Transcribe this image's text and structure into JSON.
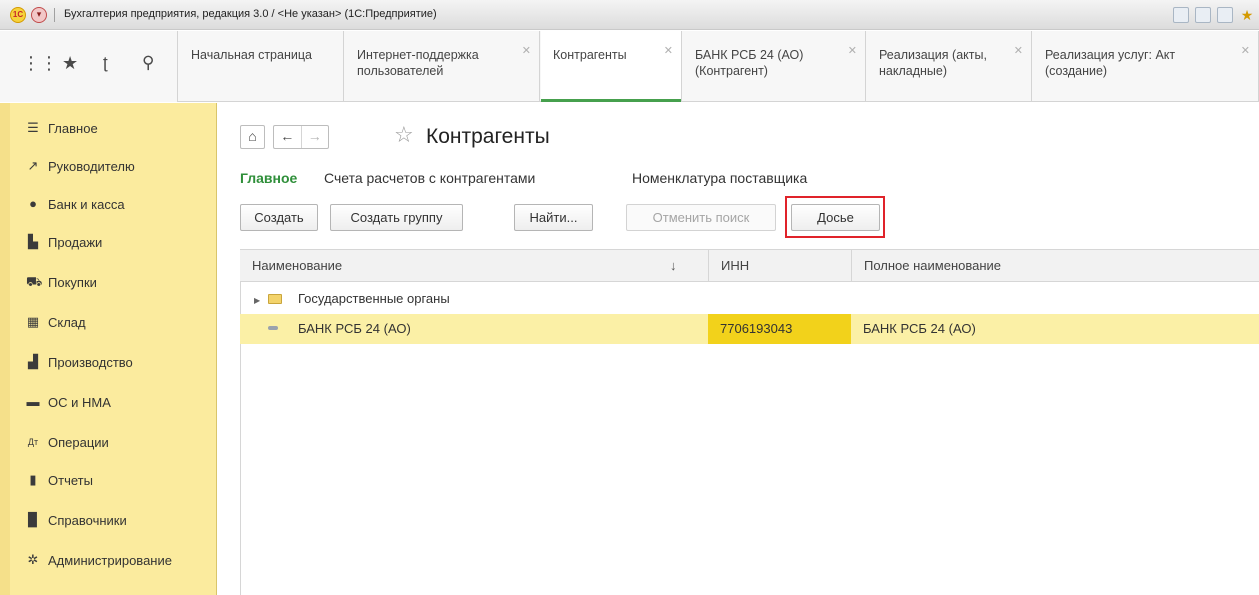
{
  "window": {
    "title": "Бухгалтерия предприятия, редакция 3.0 / <Не указан>  (1С:Предприятие)",
    "logo_text": "1С"
  },
  "quick_icons": [
    "grid-icon",
    "star-icon",
    "history-icon",
    "search-icon"
  ],
  "tabs": [
    {
      "label": "Начальная страница",
      "closable": false
    },
    {
      "label": "Интернет-поддержка пользователей",
      "closable": true
    },
    {
      "label": "Контрагенты",
      "closable": true,
      "active": true
    },
    {
      "label": "БАНК РСБ 24 (АО) (Контрагент)",
      "closable": true
    },
    {
      "label": "Реализация (акты, накладные)",
      "closable": true
    },
    {
      "label": "Реализация услуг: Акт (создание)",
      "closable": true
    }
  ],
  "sidebar": {
    "items": [
      {
        "label": "Главное",
        "icon": "menu-lines-icon"
      },
      {
        "label": "Руководителю",
        "icon": "trend-icon"
      },
      {
        "label": "Банк и касса",
        "icon": "ruble-coin-icon"
      },
      {
        "label": "Продажи",
        "icon": "shopping-bag-icon"
      },
      {
        "label": "Покупки",
        "icon": "cart-icon"
      },
      {
        "label": "Склад",
        "icon": "warehouse-icon"
      },
      {
        "label": "Производство",
        "icon": "factory-icon"
      },
      {
        "label": "ОС и НМА",
        "icon": "truck-icon"
      },
      {
        "label": "Операции",
        "icon": "dt-kt-icon"
      },
      {
        "label": "Отчеты",
        "icon": "bar-chart-icon"
      },
      {
        "label": "Справочники",
        "icon": "book-icon"
      },
      {
        "label": "Администрирование",
        "icon": "gear-icon"
      }
    ]
  },
  "main": {
    "title": "Контрагенты",
    "subnav": [
      "Главное",
      "Счета расчетов с контрагентами",
      "Номенклатура поставщика"
    ],
    "buttons": {
      "create": "Создать",
      "create_group": "Создать группу",
      "find": "Найти...",
      "cancel_search": "Отменить поиск",
      "dossier": "Досье"
    },
    "table": {
      "columns": [
        "Наименование",
        "ИНН",
        "Полное наименование"
      ],
      "sort_indicator": "↓",
      "rows": [
        {
          "name": "Государственные органы",
          "inn": "",
          "full_name": "",
          "type": "folder"
        },
        {
          "name": "БАНК РСБ 24 (АО)",
          "inn": "7706193043",
          "full_name": "БАНК РСБ 24 (АО)",
          "type": "item",
          "selected": true
        }
      ]
    }
  },
  "colors": {
    "sidebar_bg": "#fbeb9e",
    "active_tab_accent": "#46a04d",
    "subnav_active": "#2f8f3a",
    "selected_row": "#fbf0a6",
    "selected_cell": "#f2d21b",
    "highlight_frame": "#e0232a"
  }
}
